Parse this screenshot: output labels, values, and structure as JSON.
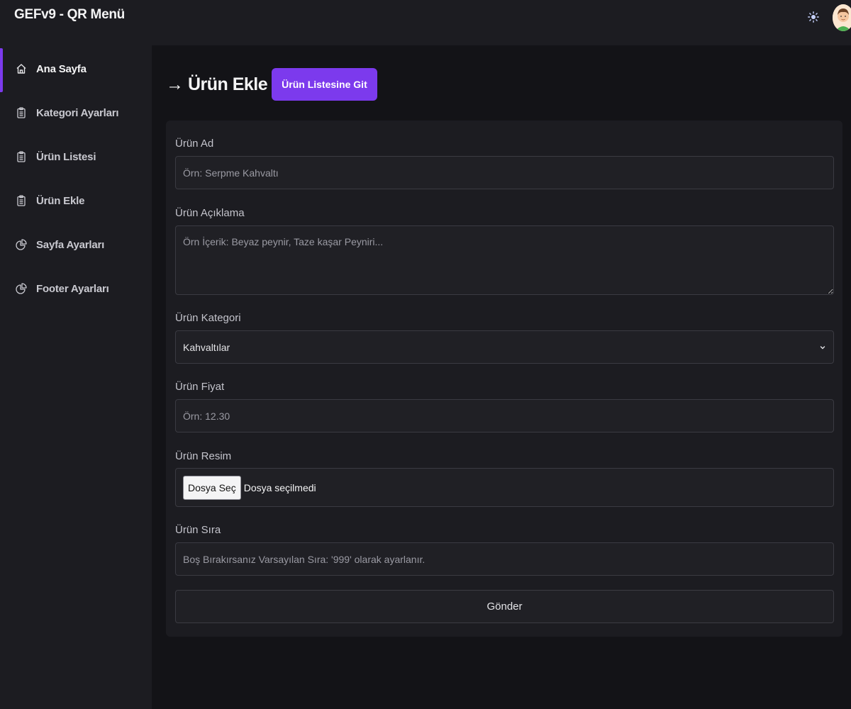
{
  "app": {
    "title": "GEFv9 - QR Menü"
  },
  "topbar": {
    "theme_icon": "sun-icon",
    "avatar_icon": "user-avatar"
  },
  "sidebar": {
    "items": [
      {
        "label": "Ana Sayfa",
        "icon": "home-icon",
        "active": true
      },
      {
        "label": "Kategori Ayarları",
        "icon": "clipboard-icon",
        "active": false
      },
      {
        "label": "Ürün Listesi",
        "icon": "clipboard-icon",
        "active": false
      },
      {
        "label": "Ürün Ekle",
        "icon": "clipboard-icon",
        "active": false
      },
      {
        "label": "Sayfa Ayarları",
        "icon": "pie-chart-icon",
        "active": false
      },
      {
        "label": "Footer Ayarları",
        "icon": "pie-chart-icon",
        "active": false
      }
    ]
  },
  "page": {
    "title": "→ Ürün Ekle",
    "list_button": "Ürün Listesine Git"
  },
  "form": {
    "name": {
      "label": "Ürün Ad",
      "placeholder": "Örn: Serpme Kahvaltı"
    },
    "description": {
      "label": "Ürün Açıklama",
      "placeholder": "Örn İçerik: Beyaz peynir, Taze kaşar Peyniri..."
    },
    "category": {
      "label": "Ürün Kategori",
      "selected": "Kahvaltılar",
      "icon": "chevron-down-icon"
    },
    "price": {
      "label": "Ürün Fiyat",
      "placeholder": "Örn: 12.30"
    },
    "image": {
      "label": "Ürün Resim",
      "button": "Dosya Seç",
      "status": "Dosya seçilmedi"
    },
    "order": {
      "label": "Ürün Sıra",
      "placeholder": "Boş Bırakırsanız Varsayılan Sıra: '999' olarak ayarlanır."
    },
    "submit": "Gönder"
  },
  "colors": {
    "accent": "#7c3aed",
    "sidebar_bg": "#1c1c21",
    "main_bg": "#131317",
    "card_bg": "#1c1c21",
    "input_bg": "#202025",
    "input_border": "#3b3b42"
  }
}
